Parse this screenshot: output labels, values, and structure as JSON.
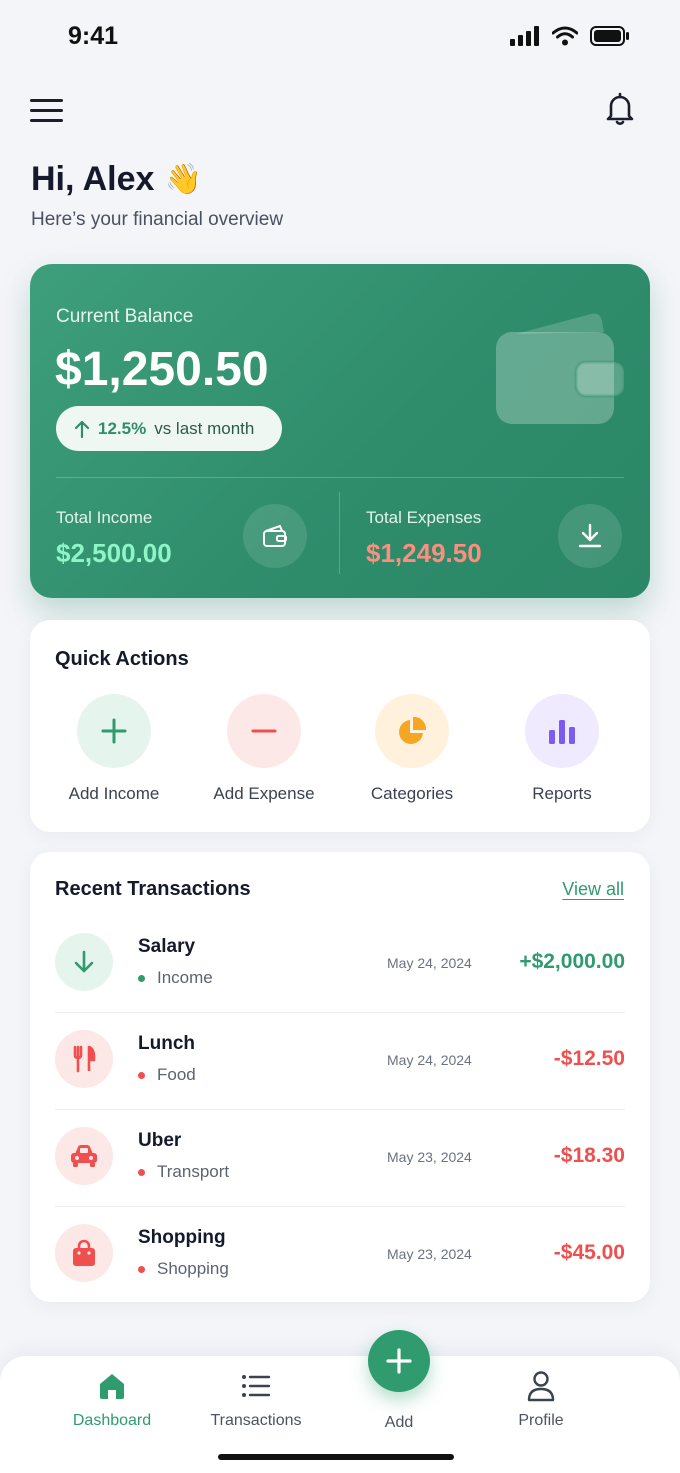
{
  "status_bar": {
    "time": "9:41"
  },
  "header": {
    "greeting": "Hi, Alex",
    "emoji": "👋",
    "subtitle": "Here’s your financial overview"
  },
  "balance": {
    "label": "Current Balance",
    "amount": "$1,250.50",
    "trend_percent": "12.5%",
    "trend_text": "vs last month",
    "income_label": "Total Income",
    "income_amount": "$2,500.00",
    "expense_label": "Total Expenses",
    "expense_amount": "$1,249.50"
  },
  "quick_actions": {
    "title": "Quick Actions",
    "items": [
      {
        "label": "Add Income",
        "icon": "plus-icon",
        "bg": "#e6f4ee",
        "color": "#2f9b6e"
      },
      {
        "label": "Add Expense",
        "icon": "minus-icon",
        "bg": "#fde8e8",
        "color": "#ef4f4f"
      },
      {
        "label": "Categories",
        "icon": "pie-chart-icon",
        "bg": "#fff1dc",
        "color": "#f5a623"
      },
      {
        "label": "Reports",
        "icon": "bar-chart-icon",
        "bg": "#efeafd",
        "color": "#7c5cf0"
      }
    ]
  },
  "transactions": {
    "title": "Recent Transactions",
    "view_all": "View all",
    "items": [
      {
        "name": "Salary",
        "category": "Income",
        "date": "May 24, 2024",
        "amount": "+$2,000.00",
        "type": "income",
        "icon": "arrow-down-icon"
      },
      {
        "name": "Lunch",
        "category": "Food",
        "date": "May 24, 2024",
        "amount": "-$12.50",
        "type": "expense",
        "icon": "fork-knife-icon"
      },
      {
        "name": "Uber",
        "category": "Transport",
        "date": "May 23, 2024",
        "amount": "-$18.30",
        "type": "expense",
        "icon": "car-icon"
      },
      {
        "name": "Shopping",
        "category": "Shopping",
        "date": "May 23, 2024",
        "amount": "-$45.00",
        "type": "expense",
        "icon": "shopping-bag-icon"
      }
    ]
  },
  "nav": {
    "items": [
      {
        "label": "Dashboard",
        "icon": "home-icon",
        "active": true
      },
      {
        "label": "Transactions",
        "icon": "list-icon",
        "active": false
      },
      {
        "label": "Add",
        "icon": "plus-icon",
        "active": false
      },
      {
        "label": "Profile",
        "icon": "user-icon",
        "active": false
      }
    ]
  },
  "colors": {
    "primary": "#2f9b6e",
    "income": "#2f9b6e",
    "expense": "#ef4f4f"
  }
}
